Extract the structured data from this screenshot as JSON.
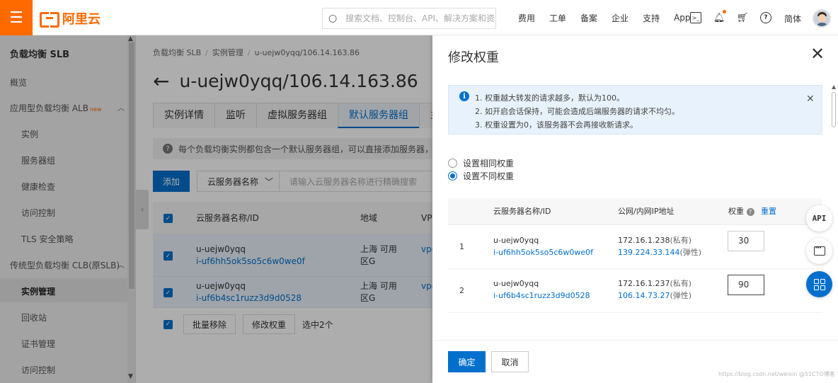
{
  "header": {
    "logo_text": "阿里云",
    "search_placeholder": "搜索文档、控制台、API、解决方案和资源",
    "links": [
      "费用",
      "工单",
      "备案",
      "企业",
      "支持",
      "App"
    ],
    "lang": "简体",
    "icons": [
      "terminal-icon",
      "bell-icon",
      "cart-icon",
      "help-icon"
    ]
  },
  "sidebar": {
    "title": "负载均衡 SLB",
    "items": [
      {
        "label": "概览",
        "level": 1
      },
      {
        "label": "应用型负载均衡 ALB",
        "badge": "new",
        "level": 1
      },
      {
        "label": "实例",
        "level": 2
      },
      {
        "label": "服务器组",
        "level": 2
      },
      {
        "label": "健康检查",
        "level": 2
      },
      {
        "label": "访问控制",
        "level": 2
      },
      {
        "label": "TLS 安全策略",
        "level": 2
      },
      {
        "label": "传统型负载均衡 CLB(原SLB)",
        "level": 1
      },
      {
        "label": "实例管理",
        "level": 2,
        "active": true
      },
      {
        "label": "回收站",
        "level": 2
      },
      {
        "label": "证书管理",
        "level": 2
      },
      {
        "label": "访问控制",
        "level": 2
      }
    ]
  },
  "main": {
    "breadcrumb": [
      "负载均衡 SLB",
      "实例管理",
      "u-uejw0yqq/106.14.163.86"
    ],
    "title": "u-uejw0yqq/106.14.163.86",
    "tabs": [
      "实例详情",
      "监听",
      "虚拟服务器组",
      "默认服务器组",
      "主备"
    ],
    "active_tab": "默认服务器组",
    "notice": "每个负载均衡实例都包含一个默认服务器组，可以直接添加服务器，但负",
    "add_button": "添加",
    "filter_select": "云服务器名称",
    "filter_placeholder": "请输入云服务器名称进行精确搜索",
    "table": {
      "columns": [
        "云服务器名称/ID",
        "地域",
        "VPC"
      ],
      "rows": [
        {
          "name": "u-uejw0yqq",
          "id": "i-uf6hh5ok5so5c6w0we0f",
          "region": "上海 可用区G",
          "vpc": "vpc"
        },
        {
          "name": "u-uejw0yqq",
          "id": "i-uf6b4sc1ruzz3d9d0528",
          "region": "上海 可用区G",
          "vpc": "vpc"
        }
      ]
    },
    "bulk_remove": "批量移除",
    "modify_weight": "修改权重",
    "selected_text": "选中2个"
  },
  "drawer": {
    "title": "修改权重",
    "info_lines": [
      "1. 权重越大转发的请求越多，默认为100。",
      "2. 如开启会话保持，可能会造成后端服务器的请求不均匀。",
      "3. 权重设置为0，该服务器不会再接收新请求。"
    ],
    "radio_same": "设置相同权重",
    "radio_diff": "设置不同权重",
    "columns": {
      "name": "云服务器名称/ID",
      "ip": "公网/内网IP地址",
      "weight": "权重",
      "reset": "重置"
    },
    "rows": [
      {
        "index": "1",
        "name": "u-uejw0yqq",
        "id": "i-uf6hh5ok5so5c6w0we0f",
        "private_ip": "172.16.1.238",
        "private_tag": "(私有)",
        "public_ip": "139.224.33.144",
        "public_tag": "(弹性)",
        "weight": "30"
      },
      {
        "index": "2",
        "name": "u-uejw0yqq",
        "id": "i-uf6b4sc1ruzz3d9d0528",
        "private_ip": "172.16.1.237",
        "private_tag": "(私有)",
        "public_ip": "106.14.73.27",
        "public_tag": "(弹性)",
        "weight": "90"
      }
    ],
    "ok": "确定",
    "cancel": "取消"
  },
  "floating": {
    "api": "API"
  },
  "watermark": "https://blog.csdn.net/weixin  @51CTO博客",
  "colors": {
    "brand": "#ff6a00",
    "primary": "#0070cc"
  }
}
